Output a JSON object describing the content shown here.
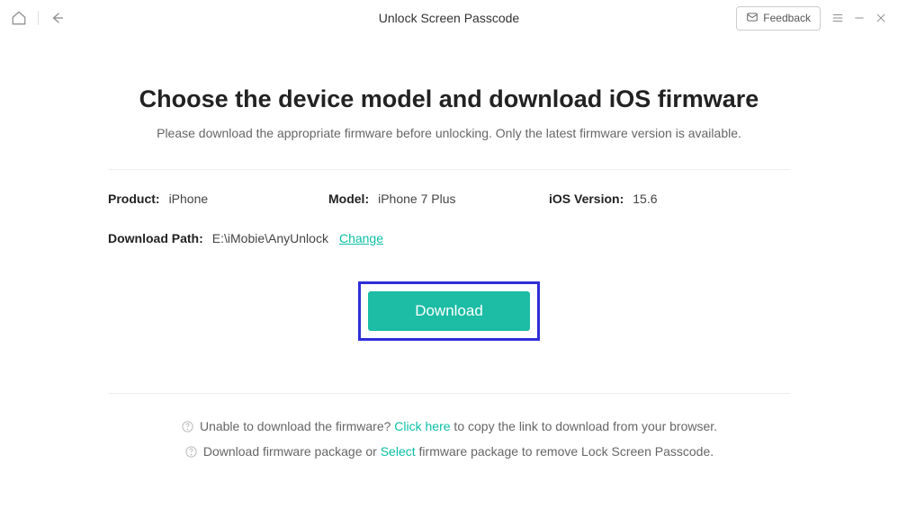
{
  "titlebar": {
    "title": "Unlock Screen Passcode",
    "feedback": "Feedback"
  },
  "main": {
    "heading": "Choose the device model and download iOS firmware",
    "subheading": "Please download the appropriate firmware before unlocking. Only the latest firmware version is available.",
    "product_label": "Product:",
    "product_value": "iPhone",
    "model_label": "Model:",
    "model_value": "iPhone 7 Plus",
    "ios_label": "iOS Version:",
    "ios_value": "15.6",
    "path_label": "Download Path:",
    "path_value": "E:\\iMobie\\AnyUnlock",
    "change_label": "Change",
    "download_label": "Download"
  },
  "hints": {
    "h1_pre": "Unable to download the firmware? ",
    "h1_link": "Click here",
    "h1_post": " to copy the link to download from your browser.",
    "h2_pre": "Download firmware package or ",
    "h2_link": "Select",
    "h2_post": " firmware package to remove Lock Screen Passcode."
  }
}
